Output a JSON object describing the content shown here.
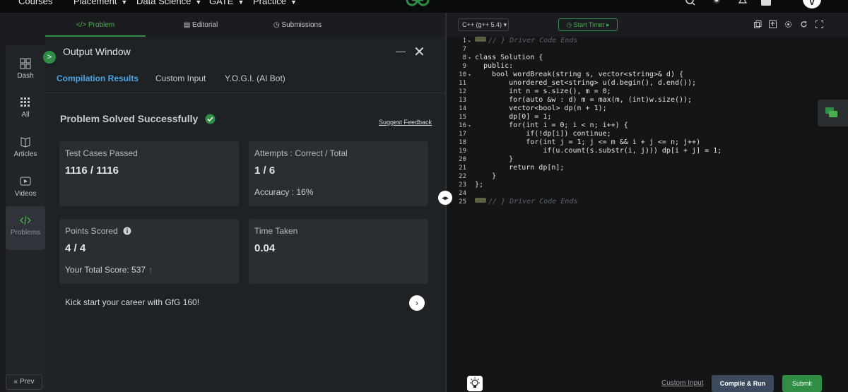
{
  "topnav": {
    "items": [
      {
        "label": "Courses"
      },
      {
        "label": "Placement"
      },
      {
        "label": "Data Science"
      },
      {
        "label": "GATE"
      },
      {
        "label": "Practice"
      }
    ],
    "avatar_letter": "V"
  },
  "sidebar": {
    "items": [
      {
        "label": "Dash",
        "icon": "dashboard-icon"
      },
      {
        "label": "All",
        "icon": "grid-icon"
      },
      {
        "label": "Articles",
        "icon": "book-icon"
      },
      {
        "label": "Videos",
        "icon": "video-icon"
      },
      {
        "label": "Problems",
        "icon": "code-icon"
      }
    ],
    "prev_label": "« Prev"
  },
  "problem_tabs": {
    "problem": "</> Problem",
    "editorial": "Editorial",
    "submissions": "Submissions"
  },
  "output_window": {
    "title": "Output Window",
    "tabs": [
      "Compilation Results",
      "Custom Input",
      "Y.O.G.I. (AI Bot)"
    ],
    "status": "Problem Solved Successfully",
    "suggest_feedback": "Suggest Feedback",
    "cards": {
      "test_cases": {
        "label": "Test Cases Passed",
        "value": "1116 / 1116"
      },
      "attempts": {
        "label": "Attempts : Correct / Total",
        "value": "1 / 6",
        "accuracy": "Accuracy : 16%"
      },
      "points": {
        "label": "Points Scored",
        "value": "4 / 4",
        "total": "Your Total Score: 537"
      },
      "time": {
        "label": "Time Taken",
        "value": "0.04"
      }
    },
    "kickstart": "Kick start your career with GfG 160!"
  },
  "editor": {
    "language": "C++ (g++ 5.4)",
    "timer": "Start Timer",
    "lines": [
      {
        "n": "1",
        "text": "// } Driver Code Ends"
      },
      {
        "n": "7",
        "text": ""
      },
      {
        "n": "8",
        "text": "class Solution {"
      },
      {
        "n": "9",
        "text": "  public:"
      },
      {
        "n": "10",
        "text": "    bool wordBreak(string s, vector<string>& d) {"
      },
      {
        "n": "11",
        "text": "        unordered_set<string> u(d.begin(), d.end());"
      },
      {
        "n": "12",
        "text": "        int n = s.size(), m = 0;"
      },
      {
        "n": "13",
        "text": "        for(auto &w : d) m = max(m, (int)w.size());"
      },
      {
        "n": "14",
        "text": "        vector<bool> dp(n + 1);"
      },
      {
        "n": "15",
        "text": "        dp[0] = 1;"
      },
      {
        "n": "16",
        "text": "        for(int i = 0; i < n; i++) {"
      },
      {
        "n": "17",
        "text": "            if(!dp[i]) continue;"
      },
      {
        "n": "18",
        "text": "            for(int j = 1; j <= m && i + j <= n; j++)"
      },
      {
        "n": "19",
        "text": "                if(u.count(s.substr(i, j))) dp[i + j] = 1;"
      },
      {
        "n": "20",
        "text": "        }"
      },
      {
        "n": "21",
        "text": "        return dp[n];"
      },
      {
        "n": "22",
        "text": "    }"
      },
      {
        "n": "23",
        "text": "};"
      },
      {
        "n": "24",
        "text": ""
      },
      {
        "n": "25",
        "text": "// } Driver Code Ends"
      }
    ],
    "custom_input": "Custom Input",
    "compile_run": "Compile & Run",
    "submit": "Submit"
  },
  "colors": {
    "accent_green": "#2f8d46",
    "link_blue": "#4aa3e2"
  }
}
